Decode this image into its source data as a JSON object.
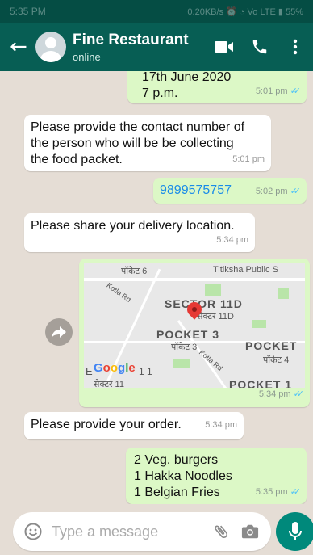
{
  "status_bar": {
    "time": "5:35 PM",
    "right": "0.20KB/s ⏰ ◔ Vo LTE ▮ 55%"
  },
  "header": {
    "back_icon": "arrow-back-icon",
    "title": "Fine Restaurant",
    "subtitle": "online"
  },
  "messages": [
    {
      "direction": "out",
      "lines": [
        "17th June 2020",
        "7 p.m."
      ],
      "time": "5:01 pm",
      "read": true
    },
    {
      "direction": "in",
      "lines": [
        "Please provide the contact number of",
        "the person who will be be collecting",
        "the food packet."
      ],
      "time": "5:01 pm"
    },
    {
      "direction": "out",
      "lines": [
        "9899575757"
      ],
      "time": "5:02 pm",
      "read": true
    },
    {
      "direction": "in",
      "lines": [
        "Please share your delivery location."
      ],
      "time": "5:34 pm"
    },
    {
      "direction": "out",
      "type": "location",
      "time": "5:34 pm",
      "read": true,
      "map_labels": [
        "पॉकेट 6",
        "Titiksha Public S",
        "Kotla Rd",
        "SECTOR 11D",
        "सेक्टर 11D",
        "POCKET 3",
        "पॉकेट 3",
        "POCKET",
        "पॉकेट 4",
        "Kotla Rd",
        "E",
        "Google",
        "1 1",
        "सेक्टर 11",
        "POCKET 1"
      ]
    },
    {
      "direction": "in",
      "lines": [
        "Please provide your order."
      ],
      "time": "5:34 pm"
    },
    {
      "direction": "out",
      "lines": [
        "2 Veg. burgers",
        "1 Hakka Noodles",
        "1 Belgian Fries"
      ],
      "time": "5:35 pm",
      "read": true
    }
  ],
  "composer": {
    "placeholder": "Type a message"
  },
  "colors": {
    "header": "#075e54",
    "outgoing": "#dcf8c6",
    "incoming": "#ffffff",
    "background": "#e5ddd5",
    "mic": "#00897b",
    "ticks": "#4fc3f7"
  }
}
